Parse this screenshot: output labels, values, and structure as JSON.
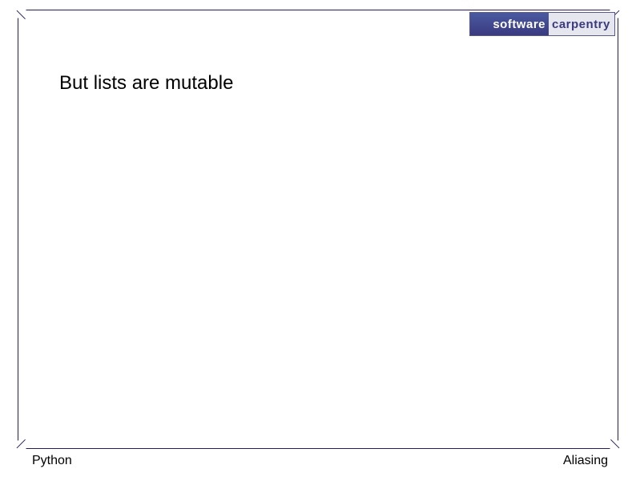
{
  "logo": {
    "word1": "software",
    "word2": "carpentry"
  },
  "body": {
    "text": "But lists are mutable"
  },
  "footer": {
    "left": "Python",
    "right": "Aliasing"
  }
}
